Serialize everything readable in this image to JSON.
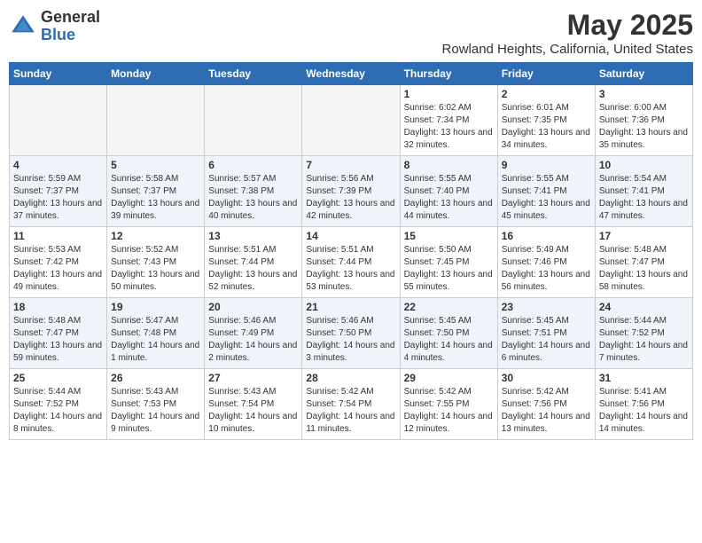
{
  "header": {
    "logo_general": "General",
    "logo_blue": "Blue",
    "month": "May 2025",
    "location": "Rowland Heights, California, United States"
  },
  "weekdays": [
    "Sunday",
    "Monday",
    "Tuesday",
    "Wednesday",
    "Thursday",
    "Friday",
    "Saturday"
  ],
  "weeks": [
    [
      {
        "day": "",
        "empty": true
      },
      {
        "day": "",
        "empty": true
      },
      {
        "day": "",
        "empty": true
      },
      {
        "day": "",
        "empty": true
      },
      {
        "day": "1",
        "sunrise": "Sunrise: 6:02 AM",
        "sunset": "Sunset: 7:34 PM",
        "daylight": "Daylight: 13 hours and 32 minutes."
      },
      {
        "day": "2",
        "sunrise": "Sunrise: 6:01 AM",
        "sunset": "Sunset: 7:35 PM",
        "daylight": "Daylight: 13 hours and 34 minutes."
      },
      {
        "day": "3",
        "sunrise": "Sunrise: 6:00 AM",
        "sunset": "Sunset: 7:36 PM",
        "daylight": "Daylight: 13 hours and 35 minutes."
      }
    ],
    [
      {
        "day": "4",
        "sunrise": "Sunrise: 5:59 AM",
        "sunset": "Sunset: 7:37 PM",
        "daylight": "Daylight: 13 hours and 37 minutes."
      },
      {
        "day": "5",
        "sunrise": "Sunrise: 5:58 AM",
        "sunset": "Sunset: 7:37 PM",
        "daylight": "Daylight: 13 hours and 39 minutes."
      },
      {
        "day": "6",
        "sunrise": "Sunrise: 5:57 AM",
        "sunset": "Sunset: 7:38 PM",
        "daylight": "Daylight: 13 hours and 40 minutes."
      },
      {
        "day": "7",
        "sunrise": "Sunrise: 5:56 AM",
        "sunset": "Sunset: 7:39 PM",
        "daylight": "Daylight: 13 hours and 42 minutes."
      },
      {
        "day": "8",
        "sunrise": "Sunrise: 5:55 AM",
        "sunset": "Sunset: 7:40 PM",
        "daylight": "Daylight: 13 hours and 44 minutes."
      },
      {
        "day": "9",
        "sunrise": "Sunrise: 5:55 AM",
        "sunset": "Sunset: 7:41 PM",
        "daylight": "Daylight: 13 hours and 45 minutes."
      },
      {
        "day": "10",
        "sunrise": "Sunrise: 5:54 AM",
        "sunset": "Sunset: 7:41 PM",
        "daylight": "Daylight: 13 hours and 47 minutes."
      }
    ],
    [
      {
        "day": "11",
        "sunrise": "Sunrise: 5:53 AM",
        "sunset": "Sunset: 7:42 PM",
        "daylight": "Daylight: 13 hours and 49 minutes."
      },
      {
        "day": "12",
        "sunrise": "Sunrise: 5:52 AM",
        "sunset": "Sunset: 7:43 PM",
        "daylight": "Daylight: 13 hours and 50 minutes."
      },
      {
        "day": "13",
        "sunrise": "Sunrise: 5:51 AM",
        "sunset": "Sunset: 7:44 PM",
        "daylight": "Daylight: 13 hours and 52 minutes."
      },
      {
        "day": "14",
        "sunrise": "Sunrise: 5:51 AM",
        "sunset": "Sunset: 7:44 PM",
        "daylight": "Daylight: 13 hours and 53 minutes."
      },
      {
        "day": "15",
        "sunrise": "Sunrise: 5:50 AM",
        "sunset": "Sunset: 7:45 PM",
        "daylight": "Daylight: 13 hours and 55 minutes."
      },
      {
        "day": "16",
        "sunrise": "Sunrise: 5:49 AM",
        "sunset": "Sunset: 7:46 PM",
        "daylight": "Daylight: 13 hours and 56 minutes."
      },
      {
        "day": "17",
        "sunrise": "Sunrise: 5:48 AM",
        "sunset": "Sunset: 7:47 PM",
        "daylight": "Daylight: 13 hours and 58 minutes."
      }
    ],
    [
      {
        "day": "18",
        "sunrise": "Sunrise: 5:48 AM",
        "sunset": "Sunset: 7:47 PM",
        "daylight": "Daylight: 13 hours and 59 minutes."
      },
      {
        "day": "19",
        "sunrise": "Sunrise: 5:47 AM",
        "sunset": "Sunset: 7:48 PM",
        "daylight": "Daylight: 14 hours and 1 minute."
      },
      {
        "day": "20",
        "sunrise": "Sunrise: 5:46 AM",
        "sunset": "Sunset: 7:49 PM",
        "daylight": "Daylight: 14 hours and 2 minutes."
      },
      {
        "day": "21",
        "sunrise": "Sunrise: 5:46 AM",
        "sunset": "Sunset: 7:50 PM",
        "daylight": "Daylight: 14 hours and 3 minutes."
      },
      {
        "day": "22",
        "sunrise": "Sunrise: 5:45 AM",
        "sunset": "Sunset: 7:50 PM",
        "daylight": "Daylight: 14 hours and 4 minutes."
      },
      {
        "day": "23",
        "sunrise": "Sunrise: 5:45 AM",
        "sunset": "Sunset: 7:51 PM",
        "daylight": "Daylight: 14 hours and 6 minutes."
      },
      {
        "day": "24",
        "sunrise": "Sunrise: 5:44 AM",
        "sunset": "Sunset: 7:52 PM",
        "daylight": "Daylight: 14 hours and 7 minutes."
      }
    ],
    [
      {
        "day": "25",
        "sunrise": "Sunrise: 5:44 AM",
        "sunset": "Sunset: 7:52 PM",
        "daylight": "Daylight: 14 hours and 8 minutes."
      },
      {
        "day": "26",
        "sunrise": "Sunrise: 5:43 AM",
        "sunset": "Sunset: 7:53 PM",
        "daylight": "Daylight: 14 hours and 9 minutes."
      },
      {
        "day": "27",
        "sunrise": "Sunrise: 5:43 AM",
        "sunset": "Sunset: 7:54 PM",
        "daylight": "Daylight: 14 hours and 10 minutes."
      },
      {
        "day": "28",
        "sunrise": "Sunrise: 5:42 AM",
        "sunset": "Sunset: 7:54 PM",
        "daylight": "Daylight: 14 hours and 11 minutes."
      },
      {
        "day": "29",
        "sunrise": "Sunrise: 5:42 AM",
        "sunset": "Sunset: 7:55 PM",
        "daylight": "Daylight: 14 hours and 12 minutes."
      },
      {
        "day": "30",
        "sunrise": "Sunrise: 5:42 AM",
        "sunset": "Sunset: 7:56 PM",
        "daylight": "Daylight: 14 hours and 13 minutes."
      },
      {
        "day": "31",
        "sunrise": "Sunrise: 5:41 AM",
        "sunset": "Sunset: 7:56 PM",
        "daylight": "Daylight: 14 hours and 14 minutes."
      }
    ]
  ]
}
